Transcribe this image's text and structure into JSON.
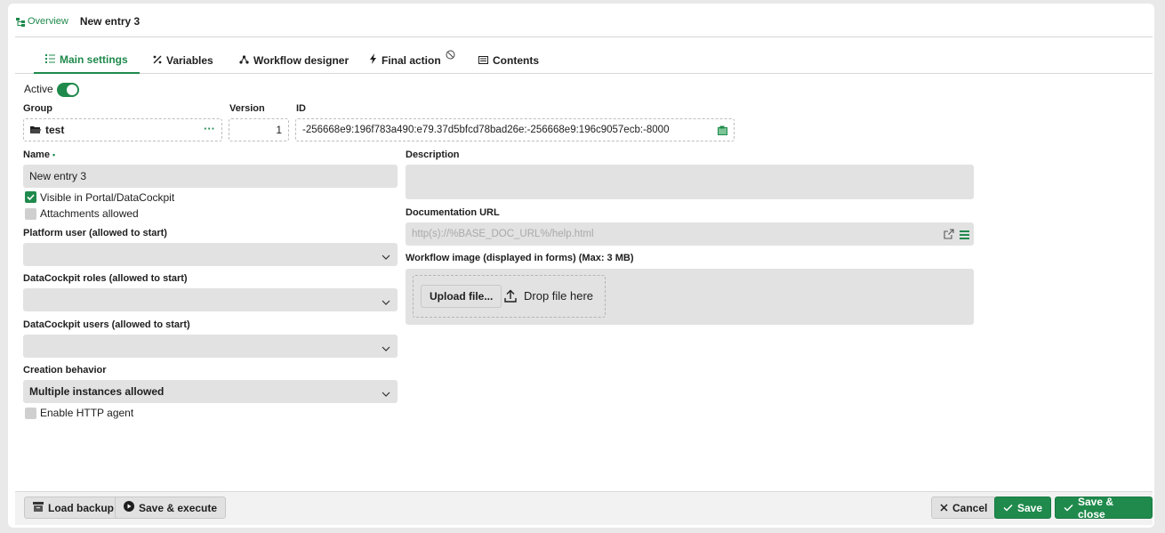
{
  "colors": {
    "accent": "#1f8a4c",
    "field_bg": "#e2e2e2",
    "footer_bg": "#f2f2f2"
  },
  "breadcrumb": {
    "overview": "Overview",
    "current": "New entry 3"
  },
  "tabs": [
    {
      "label": "Main settings",
      "icon": "list-icon",
      "active": true
    },
    {
      "label": "Variables",
      "icon": "percent-icon",
      "active": false
    },
    {
      "label": "Workflow designer",
      "icon": "workflow-icon",
      "active": false
    },
    {
      "label": "Final action",
      "icon": "lightning-icon",
      "active": false
    },
    {
      "label": "Contents",
      "icon": "contents-icon",
      "active": false
    }
  ],
  "form": {
    "active_label": "Active",
    "active_on": true,
    "group_label": "Group",
    "group_value": "test",
    "version_label": "Version",
    "version_value": "1",
    "id_label": "ID",
    "id_value": "-256668e9:196f783a490:e79.37d5bfcd78bad26e:-256668e9:196c9057ecb:-8000",
    "name_label": "Name",
    "name_required_mark": "•",
    "name_value": "New entry 3",
    "visible_label": "Visible in Portal/DataCockpit",
    "visible_checked": true,
    "attachments_label": "Attachments allowed",
    "attachments_checked": false,
    "platform_user_label": "Platform user (allowed to start)",
    "platform_user_value": "",
    "dc_roles_label": "DataCockpit roles (allowed to start)",
    "dc_roles_value": "",
    "dc_users_label": "DataCockpit users (allowed to start)",
    "dc_users_value": "",
    "creation_label": "Creation behavior",
    "creation_value": "Multiple instances allowed",
    "http_agent_label": "Enable HTTP agent",
    "http_agent_checked": false,
    "description_label": "Description",
    "description_value": "",
    "doc_url_label": "Documentation URL",
    "doc_url_placeholder": "http(s)://%BASE_DOC_URL%/help.html",
    "workflow_image_label": "Workflow image (displayed in forms) (Max: 3 MB)",
    "upload_button": "Upload file...",
    "drop_text": "Drop file here"
  },
  "footer": {
    "load_backup": "Load backup",
    "save_execute": "Save & execute",
    "cancel": "Cancel",
    "save": "Save",
    "save_close": "Save & close"
  }
}
